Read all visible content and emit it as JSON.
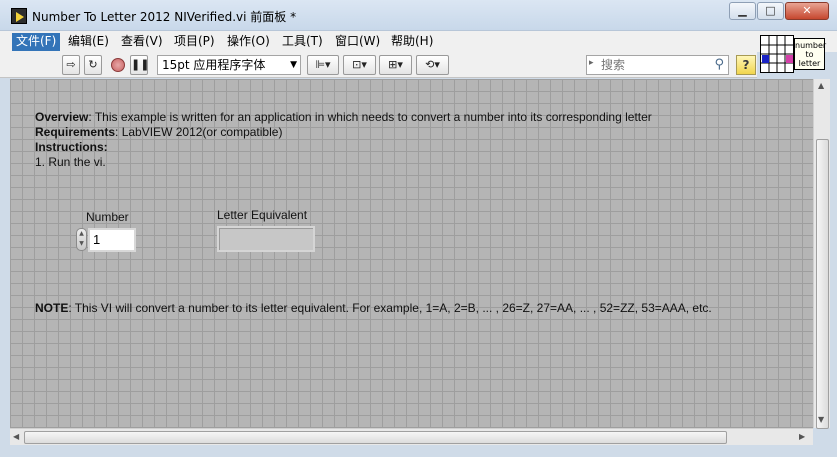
{
  "window": {
    "title": "Number To Letter 2012 NIVerified.vi 前面板 *"
  },
  "menu": {
    "items": [
      {
        "label": "文件(F)"
      },
      {
        "label": "编辑(E)"
      },
      {
        "label": "查看(V)"
      },
      {
        "label": "项目(P)"
      },
      {
        "label": "操作(O)"
      },
      {
        "label": "工具(T)"
      },
      {
        "label": "窗口(W)"
      },
      {
        "label": "帮助(H)"
      }
    ]
  },
  "toolbar": {
    "font": "15pt 应用程序字体",
    "search_placeholder": "搜索",
    "help_label": "?"
  },
  "vi_icon": {
    "line1": "number",
    "line2": "to",
    "line3": "letter"
  },
  "panel": {
    "overview_label": "Overview",
    "overview_text": ": This example is written for an application in which needs to convert a number into its corresponding letter",
    "requirements_label": "Requirements",
    "requirements_text": ": LabVIEW 2012(or compatible)",
    "instructions_label": "Instructions:",
    "instruction_1": "1. Run the vi.",
    "number_label": "Number",
    "number_value": "1",
    "letter_label": "Letter Equivalent",
    "letter_value": "",
    "note_label": "NOTE",
    "note_text": ": This VI will convert a number to its letter equivalent.  For example, 1=A, 2=B, ... , 26=Z, 27=AA, ... , 52=ZZ, 53=AAA, etc."
  }
}
